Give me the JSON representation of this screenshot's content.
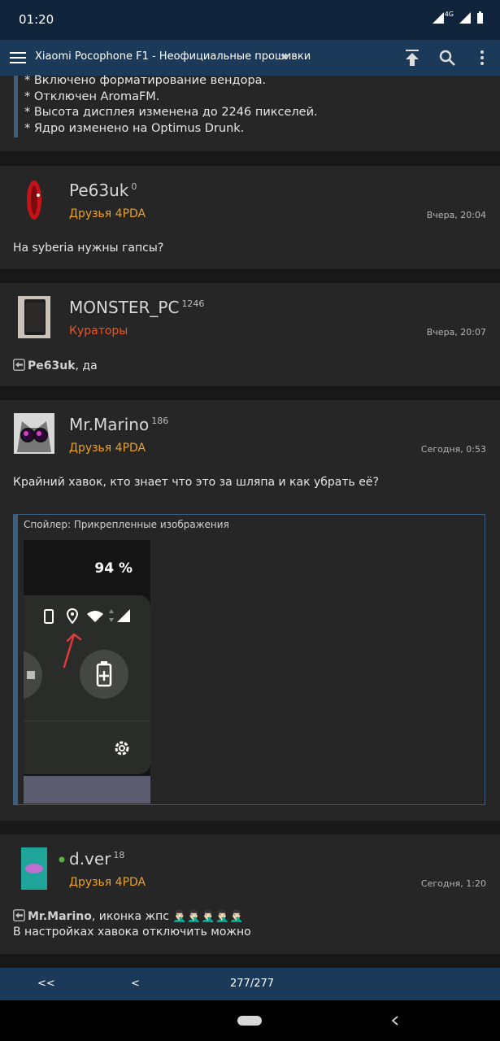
{
  "status": {
    "time": "01:20",
    "network": "4G"
  },
  "topbar": {
    "title": "Xiaomi Pocophone F1 - Неофициальные прошивки"
  },
  "top_fragment": {
    "lines": [
      "* Включено форматирование вендора.",
      "* Отключен AromaFM.",
      "* Высота дисплея изменена до 2246 пикселей.",
      "* Ядро изменено на Optimus Drunk."
    ]
  },
  "posts": [
    {
      "user": "Pe63uk",
      "rep": "0",
      "group": "Друзья 4PDA",
      "group_color": "#f0a020",
      "date": "Вчера, 20:04",
      "text": "На syberia нужны гапсы?"
    },
    {
      "user": "MONSTER_PC",
      "rep": "1246",
      "group": "Кураторы",
      "group_color": "#ee5522",
      "date": "Вчера, 20:07",
      "reply_to": "Pe63uk",
      "reply_text": ", да"
    },
    {
      "user": "Mr.Marino",
      "rep": "186",
      "group": "Друзья 4PDA",
      "group_color": "#f0a020",
      "date": "Сегодня, 0:53",
      "text": "Крайний хавок, кто знает что это за шляпа и как убрать её?",
      "spoiler": {
        "title": "Спойлер: Прикрепленные изображения",
        "battery": "94 %"
      }
    },
    {
      "user": "d.ver",
      "rep": "18",
      "group": "Друзья 4PDA",
      "group_color": "#f0a020",
      "date": "Сегодня, 1:20",
      "online": true,
      "reply_to": "Mr.Marino",
      "reply_text": ", иконка жпс 🤦🏻‍♂️🤦🏻‍♂️🤦🏻‍♂️🤦🏻‍♂️🤦🏻‍♂️",
      "text2": "В настройках хавока отключить можно"
    }
  ],
  "pager": {
    "first": "<<",
    "prev": "<",
    "page": "277/277"
  }
}
